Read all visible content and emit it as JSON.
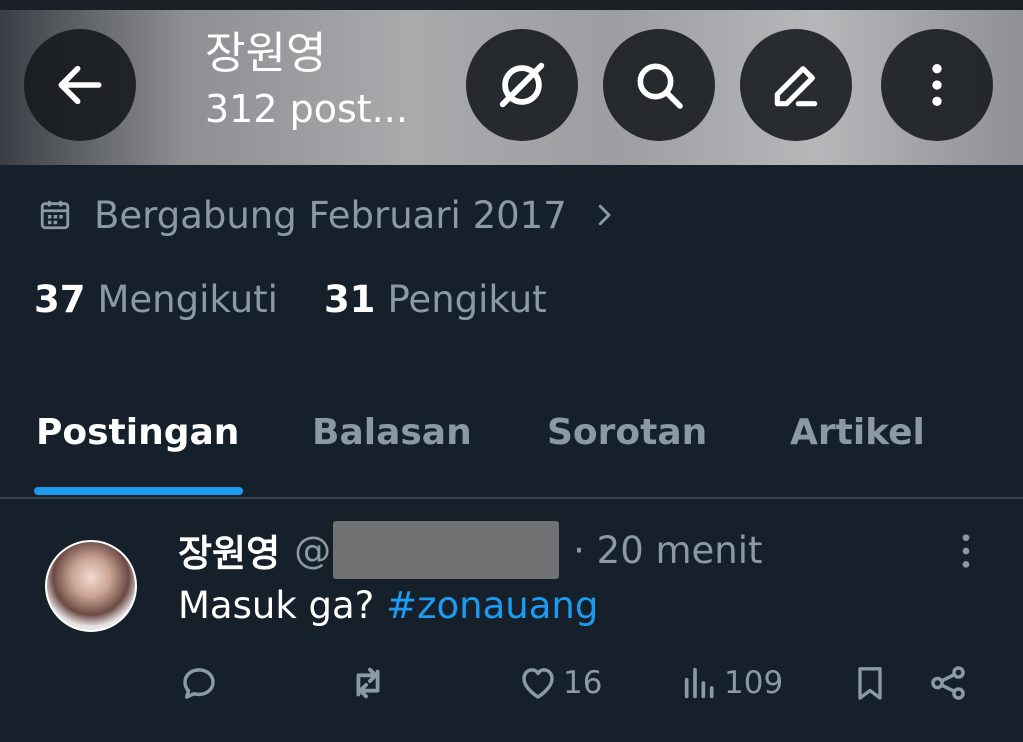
{
  "header": {
    "name": "장원영",
    "posts": "312 post...",
    "icons": [
      "back-arrow-icon",
      "grok-icon",
      "search-icon",
      "edit-icon",
      "more-vertical-icon"
    ]
  },
  "profile": {
    "joined": "Bergabung Februari 2017",
    "following_count": "37",
    "following_label": "Mengikuti",
    "followers_count": "31",
    "followers_label": "Pengikut"
  },
  "tabs": [
    "Postingan",
    "Balasan",
    "Sorotan",
    "Artikel"
  ],
  "post": {
    "name": "장원영",
    "handle_prefix": "@",
    "time": "· 20 menit",
    "text": "Masuk ga?",
    "hashtag": "#zonauang",
    "likes": "16",
    "views": "109"
  },
  "colors": {
    "background": "#15202b",
    "accent": "#1d9bf0",
    "muted": "#8b98a5"
  }
}
